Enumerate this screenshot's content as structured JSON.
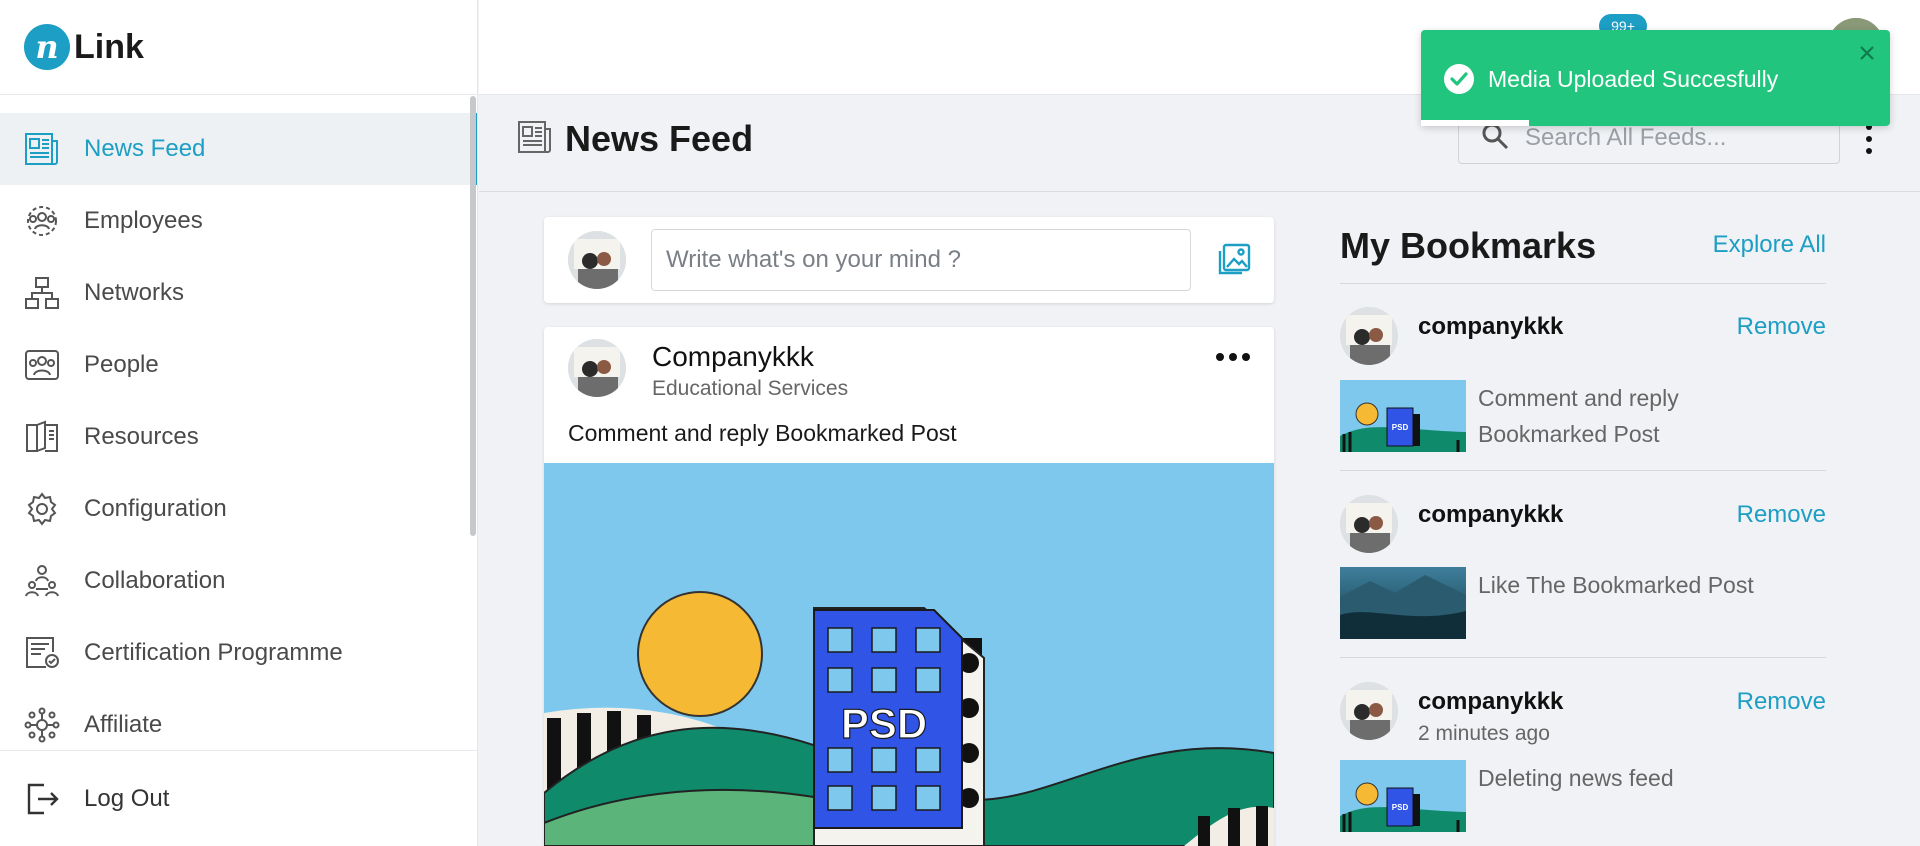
{
  "brand": {
    "logo_letter": "n",
    "logo_text": "Link"
  },
  "sidebar": {
    "items": [
      {
        "label": "News Feed",
        "icon": "newspaper-icon",
        "active": true
      },
      {
        "label": "Employees",
        "icon": "employees-icon"
      },
      {
        "label": "Networks",
        "icon": "network-icon"
      },
      {
        "label": "People",
        "icon": "people-icon"
      },
      {
        "label": "Resources",
        "icon": "book-icon"
      },
      {
        "label": "Configuration",
        "icon": "gear-icon"
      },
      {
        "label": "Collaboration",
        "icon": "collaboration-icon"
      },
      {
        "label": "Certification Programme",
        "icon": "certificate-icon"
      },
      {
        "label": "Affiliate",
        "icon": "affiliate-icon"
      }
    ],
    "logout_label": "Log Out"
  },
  "topbar": {
    "notification_count": "99+"
  },
  "header": {
    "title": "News Feed",
    "search_placeholder": "Search All Feeds..."
  },
  "composer": {
    "placeholder": "Write what's on your mind ?"
  },
  "post": {
    "author": "Companykkk",
    "subtitle": "Educational Services",
    "text": "Comment and reply Bookmarked Post",
    "image_text": "PSD"
  },
  "bookmarks": {
    "title": "My Bookmarks",
    "explore_label": "Explore All",
    "remove_label": "Remove",
    "items": [
      {
        "name": "companykkk",
        "text": "Comment and reply Bookmarked Post",
        "thumb": "psd"
      },
      {
        "name": "companykkk",
        "text": "Like The Bookmarked Post",
        "thumb": "landscape"
      },
      {
        "name": "companykkk",
        "time": "2 minutes ago",
        "text": "Deleting news feed",
        "thumb": "psd"
      }
    ]
  },
  "toast": {
    "message": "Media Uploaded Succesfully",
    "progress": 0.23
  },
  "colors": {
    "accent": "#1d9ec4",
    "success": "#22c57d"
  }
}
